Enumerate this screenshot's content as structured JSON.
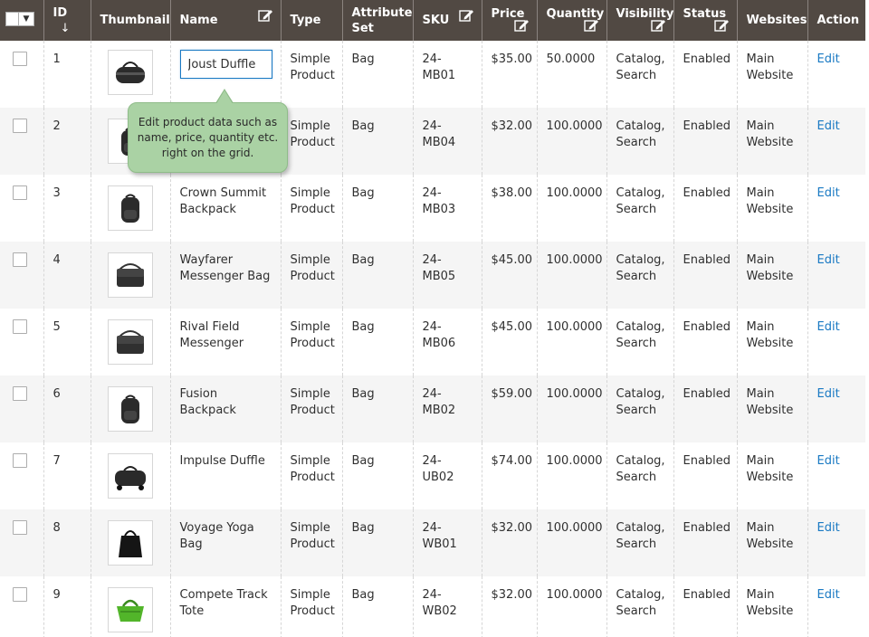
{
  "header": {
    "mass_select_arrow": "▼",
    "columns": {
      "id": "ID",
      "id_sort": "↓",
      "thumbnail": "Thumbnail",
      "name": "Name",
      "type": "Type",
      "attribute_set": "Attribute Set",
      "sku": "SKU",
      "price": "Price",
      "quantity": "Quantity",
      "visibility": "Visibility",
      "status": "Status",
      "websites": "Websites",
      "action": "Action"
    }
  },
  "tooltip": {
    "text": "Edit product data such as name, price, quantity etc. right on the grid."
  },
  "colors": {
    "header_bg": "#514943",
    "link": "#1979c3",
    "tooltip_bg": "#aad2a4",
    "row_alt": "#f5f5f5"
  },
  "rows": [
    {
      "id": "1",
      "name": "Joust Duffle",
      "type": "Simple Product",
      "attr": "Bag",
      "sku": "24-MB01",
      "price": "$35.00",
      "qty": "50.0000",
      "visibility": "Catalog, Search",
      "status": "Enabled",
      "websites": "Main Website",
      "action": "Edit",
      "thumb_icon": "duffle-bag-icon"
    },
    {
      "id": "2",
      "name": "",
      "type": "Simple Product",
      "attr": "Bag",
      "sku": "24-MB04",
      "price": "$32.00",
      "qty": "100.0000",
      "visibility": "Catalog, Search",
      "status": "Enabled",
      "websites": "Main Website",
      "action": "Edit",
      "thumb_icon": "backpack-icon"
    },
    {
      "id": "3",
      "name": "Crown Summit Backpack",
      "type": "Simple Product",
      "attr": "Bag",
      "sku": "24-MB03",
      "price": "$38.00",
      "qty": "100.0000",
      "visibility": "Catalog, Search",
      "status": "Enabled",
      "websites": "Main Website",
      "action": "Edit",
      "thumb_icon": "backpack-icon"
    },
    {
      "id": "4",
      "name": "Wayfarer Messenger Bag",
      "type": "Simple Product",
      "attr": "Bag",
      "sku": "24-MB05",
      "price": "$45.00",
      "qty": "100.0000",
      "visibility": "Catalog, Search",
      "status": "Enabled",
      "websites": "Main Website",
      "action": "Edit",
      "thumb_icon": "messenger-bag-icon"
    },
    {
      "id": "5",
      "name": "Rival Field Messenger",
      "type": "Simple Product",
      "attr": "Bag",
      "sku": "24-MB06",
      "price": "$45.00",
      "qty": "100.0000",
      "visibility": "Catalog, Search",
      "status": "Enabled",
      "websites": "Main Website",
      "action": "Edit",
      "thumb_icon": "messenger-bag-icon"
    },
    {
      "id": "6",
      "name": "Fusion Backpack",
      "type": "Simple Product",
      "attr": "Bag",
      "sku": "24-MB02",
      "price": "$59.00",
      "qty": "100.0000",
      "visibility": "Catalog, Search",
      "status": "Enabled",
      "websites": "Main Website",
      "action": "Edit",
      "thumb_icon": "backpack-icon"
    },
    {
      "id": "7",
      "name": "Impulse Duffle",
      "type": "Simple Product",
      "attr": "Bag",
      "sku": "24-UB02",
      "price": "$74.00",
      "qty": "100.0000",
      "visibility": "Catalog, Search",
      "status": "Enabled",
      "websites": "Main Website",
      "action": "Edit",
      "thumb_icon": "rolling-duffle-icon"
    },
    {
      "id": "8",
      "name": "Voyage Yoga Bag",
      "type": "Simple Product",
      "attr": "Bag",
      "sku": "24-WB01",
      "price": "$32.00",
      "qty": "100.0000",
      "visibility": "Catalog, Search",
      "status": "Enabled",
      "websites": "Main Website",
      "action": "Edit",
      "thumb_icon": "tote-bag-icon"
    },
    {
      "id": "9",
      "name": "Compete Track Tote",
      "type": "Simple Product",
      "attr": "Bag",
      "sku": "24-WB02",
      "price": "$32.00",
      "qty": "100.0000",
      "visibility": "Catalog, Search",
      "status": "Enabled",
      "websites": "Main Website",
      "action": "Edit",
      "thumb_icon": "green-tote-icon"
    }
  ]
}
